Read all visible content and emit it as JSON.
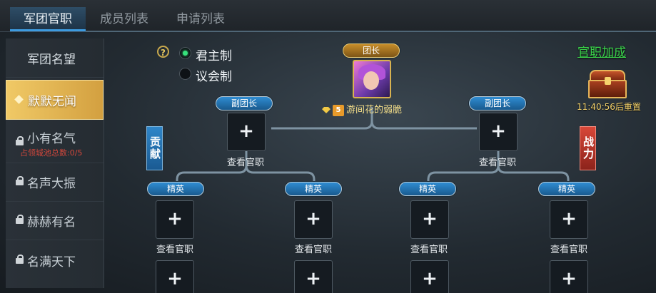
{
  "tabs": [
    {
      "label": "军团官职",
      "active": true
    },
    {
      "label": "成员列表",
      "active": false
    },
    {
      "label": "申请列表",
      "active": false
    }
  ],
  "sidebar": {
    "header": "军团名望",
    "items": [
      {
        "label": "默默无闻",
        "active": true,
        "locked": false
      },
      {
        "label": "小有名气",
        "locked": true,
        "note": "占领城池总数:0/5"
      },
      {
        "label": "名声大振",
        "locked": true
      },
      {
        "label": "赫赫有名",
        "locked": true
      },
      {
        "label": "名满天下",
        "locked": true
      }
    ]
  },
  "government": {
    "help_icon": "?",
    "options": [
      {
        "label": "君主制",
        "selected": true
      },
      {
        "label": "议会制",
        "selected": false
      }
    ]
  },
  "leader": {
    "rank": "团长",
    "vip_badge": "5",
    "name": "游间花的弱脆"
  },
  "ranks": {
    "deputy": "副团长",
    "elite": "精英"
  },
  "slot": {
    "plus": "+",
    "view_label": "查看官职"
  },
  "banners": {
    "contribution": "贡献",
    "power": "战力"
  },
  "rewards": {
    "bonus_link": "官职加成",
    "timer": "11:40:56后重置"
  },
  "colors": {
    "accent_blue": "#2f8cd2",
    "gold": "#d3a040",
    "bonus_green": "#3ad24a",
    "warning_red": "#d2473b"
  }
}
